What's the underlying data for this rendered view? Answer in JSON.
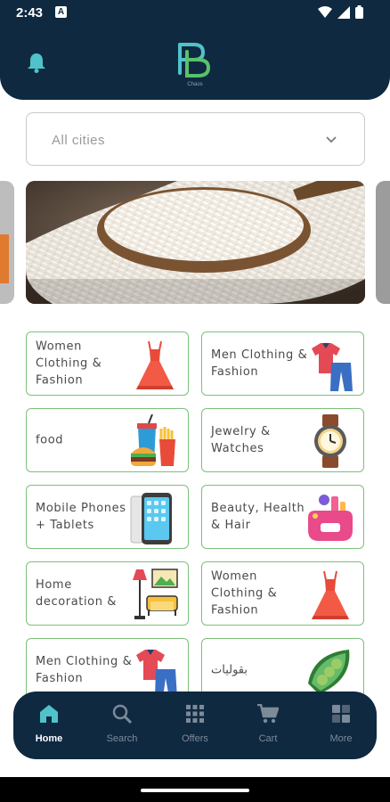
{
  "status_bar": {
    "time": "2:43",
    "notification_icon": "a-icon",
    "icons": [
      "wifi-icon",
      "signal-icon",
      "battery-icon"
    ]
  },
  "header": {
    "logo_text": "Chaos",
    "bell_icon": "bell-icon",
    "accent": "#4fc3c9",
    "bg": "#0f2941"
  },
  "city_select": {
    "value": "All cities",
    "icon": "chevron-down-icon"
  },
  "banner": {
    "image": "rice-in-wooden-bowl"
  },
  "categories": [
    {
      "label": "Women Clothing & Fashion",
      "icon": "dress-icon"
    },
    {
      "label": "Men Clothing & Fashion",
      "icon": "shirt-pants-icon"
    },
    {
      "label": "food",
      "icon": "fast-food-icon"
    },
    {
      "label": "Jewelry & Watches",
      "icon": "watch-icon"
    },
    {
      "label": "Mobile Phones + Tablets",
      "icon": "smartphone-icon"
    },
    {
      "label": "Beauty, Health & Hair",
      "icon": "cosmetics-icon"
    },
    {
      "label": "Home decoration &",
      "icon": "home-decor-icon"
    },
    {
      "label": "Women Clothing & Fashion",
      "icon": "dress-icon"
    },
    {
      "label": "Men Clothing & Fashion",
      "icon": "shirt-pants-icon"
    },
    {
      "label": "بقوليات",
      "icon": "peas-icon"
    }
  ],
  "bottom_nav": [
    {
      "label": "Home",
      "icon": "home-icon",
      "active": true
    },
    {
      "label": "Search",
      "icon": "search-icon",
      "active": false
    },
    {
      "label": "Offers",
      "icon": "grid-icon",
      "active": false
    },
    {
      "label": "Cart",
      "icon": "cart-icon",
      "active": false
    },
    {
      "label": "More",
      "icon": "more-icon",
      "active": false
    }
  ]
}
